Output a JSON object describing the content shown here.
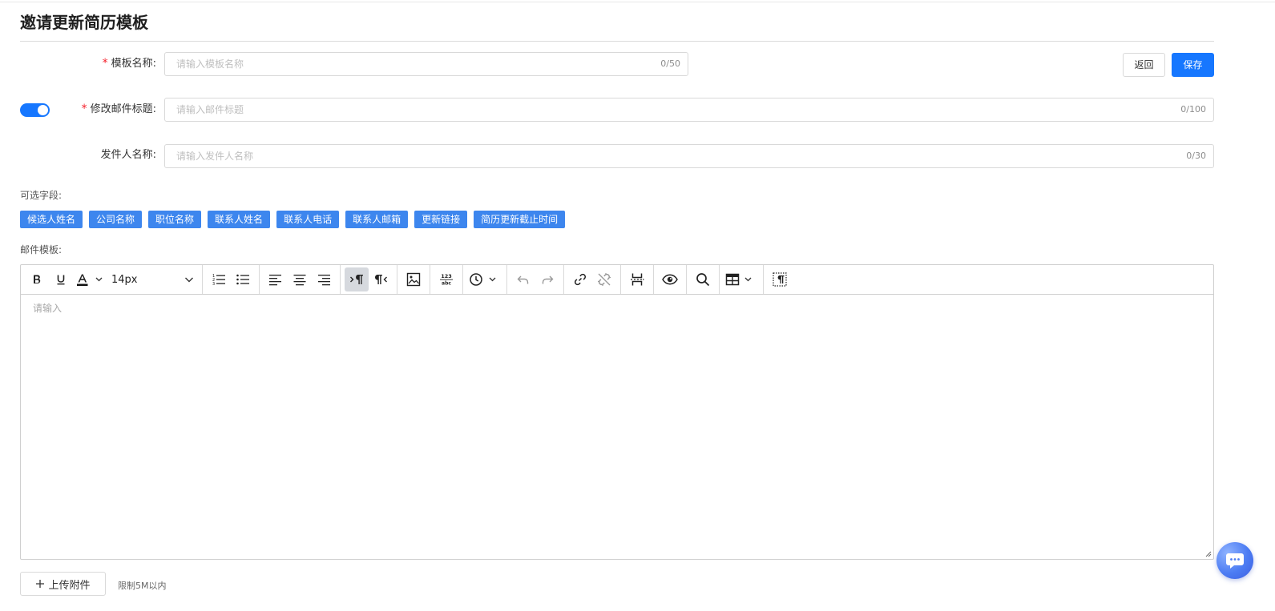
{
  "page": {
    "title": "邀请更新简历模板"
  },
  "form": {
    "template_name": {
      "label": "模板名称:",
      "placeholder": "请输入模板名称",
      "counter": "0/50",
      "required": true
    },
    "email_subject": {
      "label": "修改邮件标题:",
      "placeholder": "请输入邮件标题",
      "counter": "0/100",
      "required": true,
      "toggle_on": true
    },
    "sender_name": {
      "label": "发件人名称:",
      "placeholder": "请输入发件人名称",
      "counter": "0/30",
      "required": false
    }
  },
  "actions": {
    "back_label": "返回",
    "save_label": "保存"
  },
  "optional_fields": {
    "label": "可选字段:",
    "tags": [
      "候选人姓名",
      "公司名称",
      "职位名称",
      "联系人姓名",
      "联系人电话",
      "联系人邮箱",
      "更新链接",
      "简历更新截止时间"
    ]
  },
  "email_template": {
    "label": "邮件模板:",
    "placeholder": "请输入",
    "font_size": "14px"
  },
  "toolbar_icons": [
    "bold-icon",
    "underline-icon",
    "font-color-icon",
    "ordered-list-icon",
    "bullet-list-icon",
    "align-left-icon",
    "align-center-icon",
    "align-right-icon",
    "ltr-icon",
    "rtl-icon",
    "image-icon",
    "character-count-icon",
    "clock-icon",
    "undo-icon",
    "redo-icon",
    "link-icon",
    "unlink-icon",
    "page-break-icon",
    "preview-icon",
    "search-icon",
    "table-icon",
    "show-blocks-icon"
  ],
  "colors": {
    "primary": "#1677ff",
    "tag": "#3d86ee",
    "required": "#f5222d"
  },
  "upload": {
    "label": "上传附件",
    "hint": "限制5M以内"
  }
}
